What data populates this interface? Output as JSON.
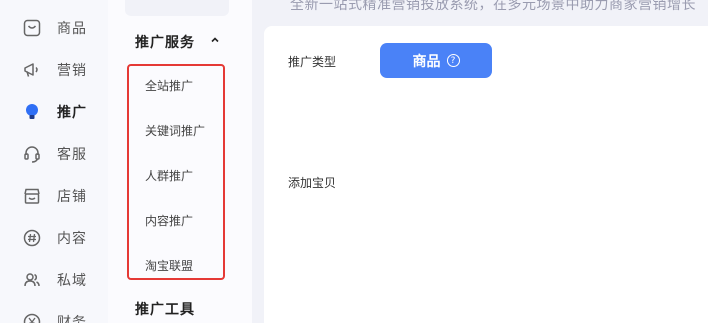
{
  "nav": {
    "items": [
      {
        "label": "商品",
        "icon": "product-icon"
      },
      {
        "label": "营销",
        "icon": "megaphone-icon"
      },
      {
        "label": "推广",
        "icon": "lightbulb-icon",
        "active": true
      },
      {
        "label": "客服",
        "icon": "headset-icon"
      },
      {
        "label": "店铺",
        "icon": "shop-icon"
      },
      {
        "label": "内容",
        "icon": "hash-icon"
      },
      {
        "label": "私域",
        "icon": "users-icon"
      },
      {
        "label": "财务",
        "icon": "yen-icon"
      }
    ],
    "active_color": "#2f6ff5"
  },
  "submenu": {
    "group_title": "推广服务",
    "items": [
      {
        "label": "全站推广"
      },
      {
        "label": "关键词推广"
      },
      {
        "label": "人群推广"
      },
      {
        "label": "内容推广"
      },
      {
        "label": "淘宝联盟"
      }
    ],
    "group_title_2": "推广工具",
    "highlight_color": "#e53935"
  },
  "main": {
    "banner": "全新一站式精准营销投放系统，在多元场景中助力商家营销增长",
    "promo_type_label": "推广类型",
    "promo_type_button": "商品",
    "help_glyph": "?",
    "add_item_label": "添加宝贝",
    "accent": "#4a82f7"
  }
}
